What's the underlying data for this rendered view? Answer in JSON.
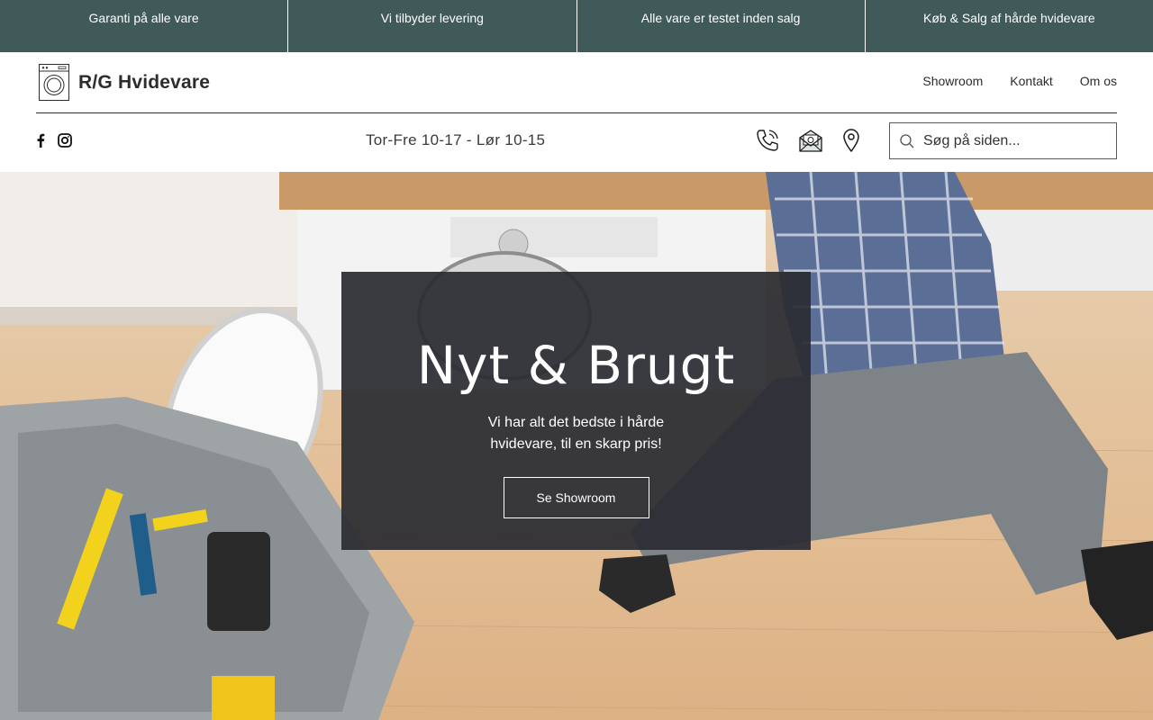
{
  "promo": [
    "Garanti på alle vare",
    "Vi tilbyder levering",
    "Alle vare er testet inden salg",
    "Køb & Salg af hårde hvidevare"
  ],
  "brand": {
    "name": "R/G Hvidevare"
  },
  "nav": [
    "Showroom",
    "Kontakt",
    "Om os"
  ],
  "hours": "Tor-Fre 10-17 - Lør 10-15",
  "search": {
    "placeholder": "Søg på siden..."
  },
  "hero": {
    "title": "Nyt & Brugt",
    "subtitle": "Vi har alt det bedste i hårde hvidevare, til en skarp pris!",
    "button": "Se Showroom"
  },
  "colors": {
    "promo_bg": "#3f5a58",
    "card_bg": "#2b2c33",
    "text": "#2c2c2c"
  },
  "icons": [
    "washing-machine-icon",
    "facebook-icon",
    "instagram-icon",
    "phone-icon",
    "mail-icon",
    "location-pin-icon",
    "search-icon"
  ]
}
